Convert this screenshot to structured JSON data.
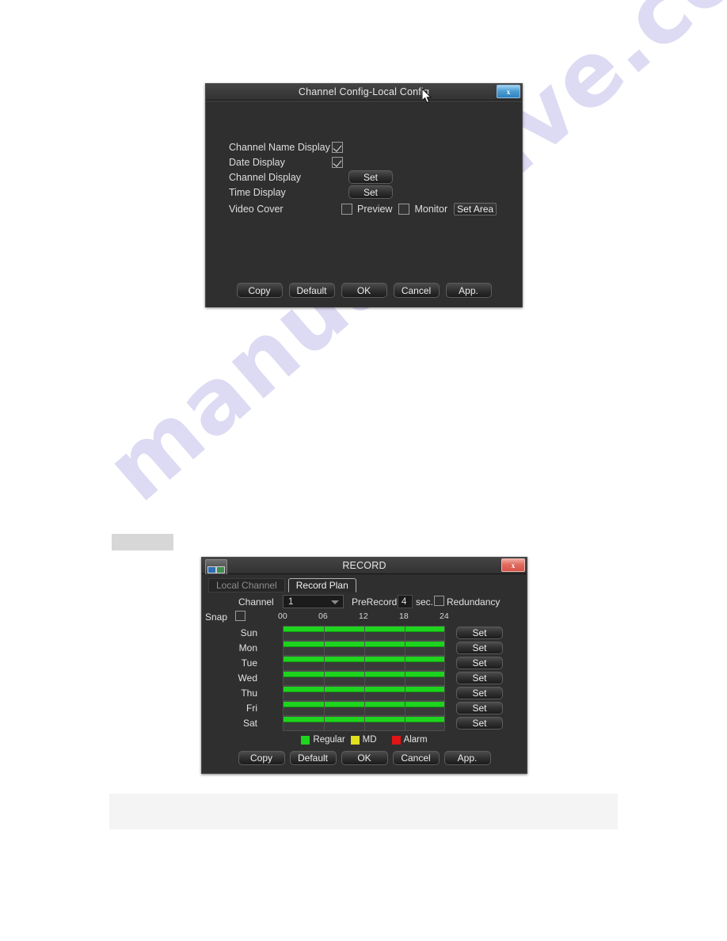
{
  "page": {
    "watermark": "manualshive.com",
    "background_color": "#ffffff"
  },
  "colors": {
    "dialog_bg": "#2f2f2f",
    "titlebar": "#3a3a3a",
    "close_blue": "#4e9fd4",
    "close_red": "#e06b5e",
    "schedule_regular": "#1ed41e",
    "schedule_md": "#e0e01e",
    "schedule_alarm": "#e01515",
    "text": "#e2e2e2"
  },
  "channel_config_dialog": {
    "title": "Channel Config-Local Config",
    "close_label": "x",
    "close_icon": "close-icon",
    "cursor_icon": "mouse-pointer-icon",
    "rows": [
      {
        "label": "Channel Name Display",
        "control": "checkbox",
        "checked": true
      },
      {
        "label": "Date Display",
        "control": "checkbox",
        "checked": true
      },
      {
        "label": "Channel Display",
        "control": "button",
        "button_label": "Set"
      },
      {
        "label": "Time Display",
        "control": "button",
        "button_label": "Set"
      },
      {
        "label": "Video Cover",
        "control": "cover"
      }
    ],
    "video_cover": {
      "preview_label": "Preview",
      "preview_checked": false,
      "monitor_label": "Monitor",
      "monitor_checked": false,
      "set_area_label": "Set Area"
    },
    "footer_buttons": [
      "Copy",
      "Default",
      "OK",
      "Cancel",
      "App."
    ]
  },
  "record_dialog": {
    "title": "RECORD",
    "close_label": "x",
    "close_icon": "close-icon",
    "titlebar_icon": "record-monitor-icon",
    "tabs": [
      {
        "label": "Local Channel",
        "active": false
      },
      {
        "label": "Record Plan",
        "active": true
      }
    ],
    "channel_label": "Channel",
    "channel_value": "1",
    "prerecord_label": "PreRecord",
    "prerecord_value": "4",
    "sec_label": "sec.",
    "redundancy_label": "Redundancy",
    "redundancy_checked": false,
    "snap_label": "Snap",
    "snap_checked": false,
    "hour_ticks": [
      "00",
      "06",
      "12",
      "18",
      "24"
    ],
    "schedule_rows": [
      {
        "day": "Sun",
        "set_label": "Set",
        "bar_start_pct": 0,
        "bar_end_pct": 100
      },
      {
        "day": "Mon",
        "set_label": "Set",
        "bar_start_pct": 0,
        "bar_end_pct": 100
      },
      {
        "day": "Tue",
        "set_label": "Set",
        "bar_start_pct": 0,
        "bar_end_pct": 100
      },
      {
        "day": "Wed",
        "set_label": "Set",
        "bar_start_pct": 0,
        "bar_end_pct": 100
      },
      {
        "day": "Thu",
        "set_label": "Set",
        "bar_start_pct": 0,
        "bar_end_pct": 100
      },
      {
        "day": "Fri",
        "set_label": "Set",
        "bar_start_pct": 0,
        "bar_end_pct": 100
      },
      {
        "day": "Sat",
        "set_label": "Set",
        "bar_start_pct": 0,
        "bar_end_pct": 100
      }
    ],
    "legend": [
      {
        "label": "Regular",
        "color": "#1ed41e"
      },
      {
        "label": "MD",
        "color": "#e0e01e"
      },
      {
        "label": "Alarm",
        "color": "#e01515"
      }
    ],
    "footer_buttons": [
      "Copy",
      "Default",
      "OK",
      "Cancel",
      "App."
    ]
  }
}
